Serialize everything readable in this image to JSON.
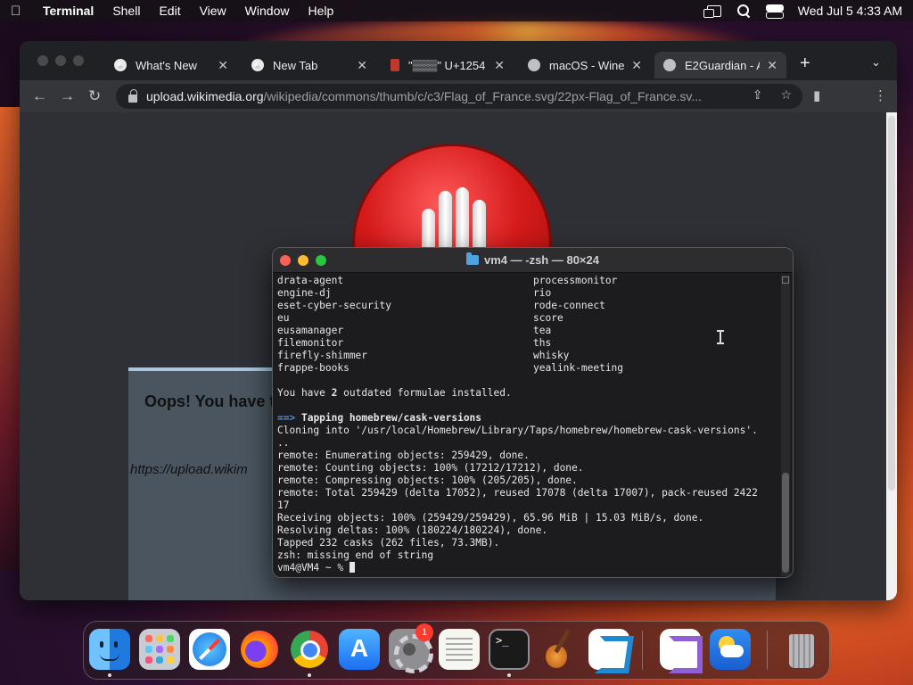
{
  "menubar": {
    "app": "Terminal",
    "items": [
      "Shell",
      "Edit",
      "View",
      "Window",
      "Help"
    ],
    "clock": "Wed Jul 5  4:33 AM"
  },
  "browser": {
    "tabs": [
      {
        "label": "What's New",
        "favicon": "chrome-icon"
      },
      {
        "label": "New Tab",
        "favicon": "chrome-icon"
      },
      {
        "label": "\"▒▒▒\" U+1254",
        "favicon": "red-page-icon"
      },
      {
        "label": "macOS - WineH",
        "favicon": "globe-icon"
      },
      {
        "label": "E2Guardian - A",
        "favicon": "globe-icon"
      }
    ],
    "url_host": "upload.wikimedia.org",
    "url_path": "/wikipedia/commons/thumb/c/c3/Flag_of_France.svg/22px-Flag_of_France.sv...",
    "page": {
      "title": "Oops! You have t",
      "blocked_url": "https://upload.wikim"
    }
  },
  "terminal": {
    "title": "vm4 — -zsh — 80×24",
    "list_left": [
      "drata-agent",
      "engine-dj",
      "eset-cyber-security",
      "eu",
      "eusamanager",
      "filemonitor",
      "firefly-shimmer",
      "frappe-books"
    ],
    "list_right": [
      "processmonitor",
      "rio",
      "rode-connect",
      "score",
      "tea",
      "ths",
      "whisky",
      "yealink-meeting"
    ],
    "outdated_prefix": "You have ",
    "outdated_count": "2",
    "outdated_suffix": " outdated formulae installed.",
    "tap_arrow": "==>",
    "tap_text": "Tapping homebrew/cask-versions",
    "output_lines": [
      "Cloning into '/usr/local/Homebrew/Library/Taps/homebrew/homebrew-cask-versions'.",
      "..",
      "remote: Enumerating objects: 259429, done.",
      "remote: Counting objects: 100% (17212/17212), done.",
      "remote: Compressing objects: 100% (205/205), done.",
      "remote: Total 259429 (delta 17052), reused 17078 (delta 17007), pack-reused 2422",
      "17",
      "Receiving objects: 100% (259429/259429), 65.96 MiB | 15.03 MiB/s, done.",
      "Resolving deltas: 100% (180224/180224), done.",
      "Tapped 232 casks (262 files, 73.3MB).",
      "zsh: missing end of string"
    ],
    "prompt": "vm4@VM4 ~ % "
  },
  "dock": {
    "items": [
      {
        "name": "finder",
        "running": true
      },
      {
        "name": "launchpad",
        "running": false
      },
      {
        "name": "safari",
        "running": false
      },
      {
        "name": "firefox",
        "running": false
      },
      {
        "name": "chrome",
        "running": true
      },
      {
        "name": "app-store",
        "running": false
      },
      {
        "name": "system-settings",
        "running": false,
        "badge": "1"
      },
      {
        "name": "textedit",
        "running": false
      },
      {
        "name": "terminal",
        "running": true
      },
      {
        "name": "garageband",
        "running": false
      },
      {
        "name": "vscode",
        "running": false
      },
      {
        "name": "visual-studio",
        "running": false
      },
      {
        "name": "weather",
        "running": false
      },
      {
        "name": "trash",
        "running": false
      }
    ]
  }
}
